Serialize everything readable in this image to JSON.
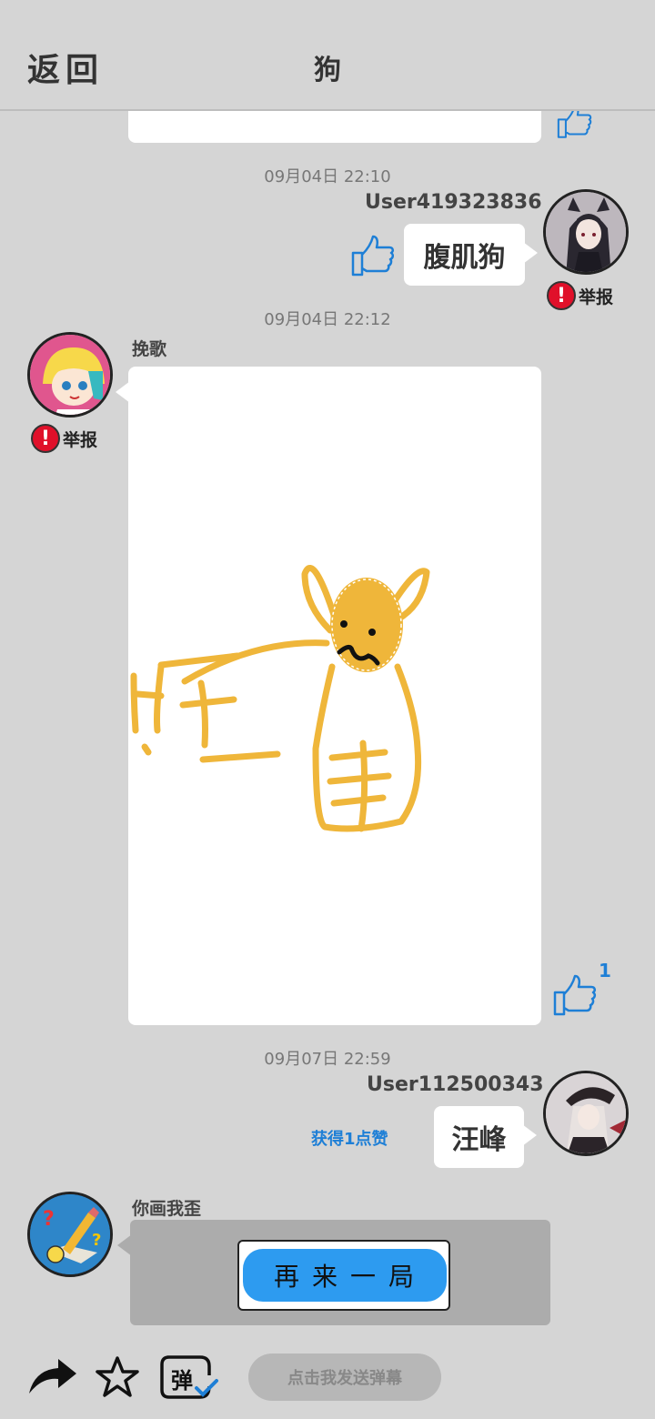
{
  "header": {
    "back_label": "返回",
    "title": "狗"
  },
  "messages": [
    {
      "timestamp": "09月04日 22:10",
      "username": "User419323836",
      "text": "腹肌狗",
      "report_label": "举报"
    },
    {
      "timestamp": "09月04日 22:12",
      "username": "挽歌",
      "report_label": "举报",
      "like_count": "1",
      "drawing_text": "旺 手"
    },
    {
      "timestamp": "09月07日 22:59",
      "username": "User112500343",
      "text": "汪峰",
      "likes_received": "获得1点赞"
    },
    {
      "username": "你画我歪",
      "button_label": "再来一局"
    }
  ],
  "bottom": {
    "danmaku_placeholder": "点击我发送弹幕",
    "danmaku_icon_label": "弹"
  },
  "colors": {
    "background": "#d5d5d5",
    "accent_blue": "#1e7fd6",
    "report_red": "#e0102a",
    "drawing_yellow": "#efb63a"
  },
  "icons": [
    "thumbs-up-icon",
    "report-icon",
    "share-icon",
    "star-icon",
    "danmaku-icon"
  ]
}
